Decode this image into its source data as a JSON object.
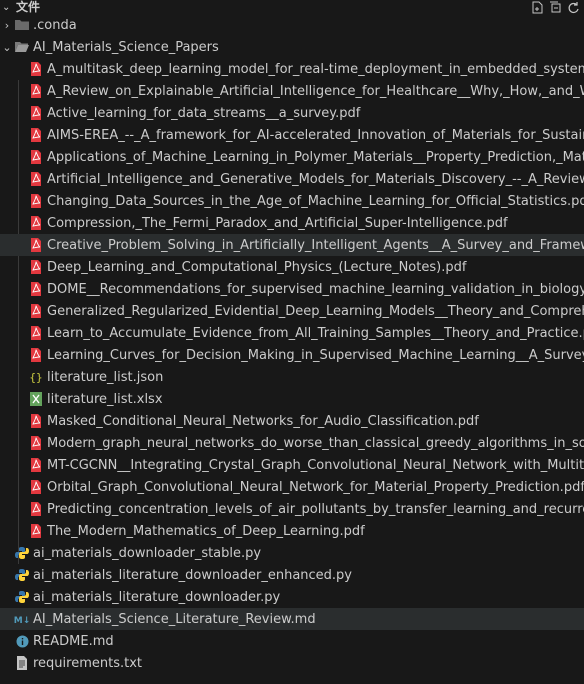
{
  "header": {
    "title": "文件"
  },
  "tree": {
    "conda": ".conda",
    "papers_folder": "AI_Materials_Science_Papers",
    "files": [
      "A_multitask_deep_learning_model_for_real-time_deployment_in_embedded_systems.pdf",
      "A_Review_on_Explainable_Artificial_Intelligence_for_Healthcare__Why,_How,_and_When_.pdf",
      "Active_learning_for_data_streams__a_survey.pdf",
      "AIMS-EREA_--_A_framework_for_AI-accelerated_Innovation_of_Materials_for_Sustainability_--_f",
      "Applications_of_Machine_Learning_in_Polymer_Materials__Property_Prediction,_Material_Design",
      "Artificial_Intelligence_and_Generative_Models_for_Materials_Discovery_--_A_Review.pdf",
      "Changing_Data_Sources_in_the_Age_of_Machine_Learning_for_Official_Statistics.pdf",
      "Compression,_The_Fermi_Paradox_and_Artificial_Super-Intelligence.pdf",
      "Creative_Problem_Solving_in_Artificially_Intelligent_Agents__A_Survey_and_Framework.pdf",
      "Deep_Learning_and_Computational_Physics_(Lecture_Notes).pdf",
      "DOME__Recommendations_for_supervised_machine_learning_validation_in_biology.pdf",
      "Generalized_Regularized_Evidential_Deep_Learning_Models__Theory_and_Comprehensive_Evalu",
      "Learn_to_Accumulate_Evidence_from_All_Training_Samples__Theory_and_Practice.pdf",
      "Learning_Curves_for_Decision_Making_in_Supervised_Machine_Learning__A_Survey.pdf",
      "literature_list.json",
      "literature_list.xlsx",
      "Masked_Conditional_Neural_Networks_for_Audio_Classification.pdf",
      "Modern_graph_neural_networks_do_worse_than_classical_greedy_algorithms_in_solving_combi",
      "MT-CGCNN__Integrating_Crystal_Graph_Convolutional_Neural_Network_with_Multitask_Learnin",
      "Orbital_Graph_Convolutional_Neural_Network_for_Material_Property_Prediction.pdf",
      "Predicting_concentration_levels_of_air_pollutants_by_transfer_learning_and_recurrent_neural_ne",
      "The_Modern_Mathematics_of_Deep_Learning.pdf"
    ],
    "root_files": [
      "ai_materials_downloader_stable.py",
      "ai_materials_literature_downloader_enhanced.py",
      "ai_materials_literature_downloader.py",
      "AI_Materials_Science_Literature_Review.md",
      "README.md",
      "requirements.txt"
    ]
  },
  "colors": {
    "pdf": "#e2383f",
    "json": "#cbcb41",
    "xlsx": "#63a35c",
    "python_blue": "#3776ab",
    "python_yellow": "#ffd43b",
    "markdown": "#519aba",
    "info": "#519aba"
  }
}
